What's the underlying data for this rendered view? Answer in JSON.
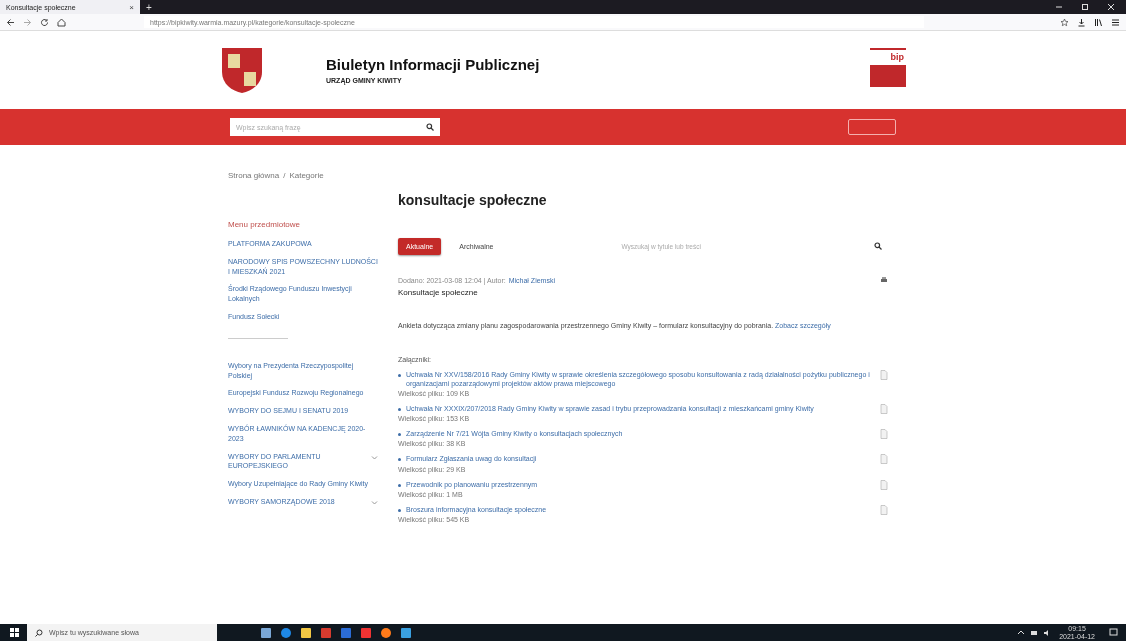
{
  "browser": {
    "tab_title": "Konsultacje społeczne",
    "tab_close": "×",
    "new_tab": "+",
    "url": "https://bipkiwity.warmia.mazury.pl/kategorie/konsultacje-spoleczne"
  },
  "header": {
    "title": "Biuletyn Informacji Publicznej",
    "subtitle": "URZĄD GMINY KIWITY",
    "badge": "bip"
  },
  "search": {
    "placeholder": "Wpisz szukaną frazę"
  },
  "breadcrumb": {
    "items": [
      "Strona główna",
      "Kategorie"
    ],
    "separator": "/"
  },
  "sidebar": {
    "heading": "Menu przedmiotowe",
    "groups": [
      [
        {
          "label": "PLATFORMA ZAKUPOWA",
          "kind": "link"
        },
        {
          "label": "NARODOWY SPIS POWSZECHNY LUDNOŚCI I MIESZKAŃ 2021",
          "kind": "link"
        },
        {
          "label": "Środki Rządowego Funduszu Inwestycji Lokalnych",
          "kind": "link"
        },
        {
          "label": "Fundusz Sołecki",
          "kind": "link"
        }
      ],
      [
        {
          "label": "Wybory na Prezydenta Rzeczypospolitej Polskiej",
          "kind": "link"
        },
        {
          "label": "Europejski Fundusz Rozwoju Regionalnego",
          "kind": "link"
        },
        {
          "label": "WYBORY DO SEJMU I SENATU 2019",
          "kind": "link"
        },
        {
          "label": "WYBÓR ŁAWNIKÓW NA KADENCJĘ 2020-2023",
          "kind": "link"
        },
        {
          "label": "WYBORY DO PARLAMENTU EUROPEJSKIEGO",
          "kind": "expandable"
        },
        {
          "label": "Wybory Uzupełniające do Rady Gminy Kiwity",
          "kind": "link"
        },
        {
          "label": "WYBORY SAMORZĄDOWE 2018",
          "kind": "expandable"
        }
      ]
    ]
  },
  "content": {
    "title": "konsultacje społeczne",
    "tabs": [
      {
        "label": "Aktualne",
        "selected": true
      },
      {
        "label": "Archiwalne",
        "selected": false
      }
    ],
    "filter_placeholder": "Wyszukaj w tytule lub treści",
    "meta": "Dodano: 2021-03-08 12:04 | Autor:",
    "author": "Michał Ziemski",
    "article_title": "Konsultacje społeczne",
    "text": "Ankieta dotycząca zmiany planu zagospodarowania przestrzennego Gminy Kiwity – formularz konsultacyjny do pobrania.",
    "text_link": "Zobacz szczegóły",
    "attachments_heading": "Załączniki:",
    "attachments": [
      {
        "name": "Uchwała Nr XXV/158/2016 Rady Gminy Kiwity w sprawie określenia szczegółowego sposobu konsultowania z radą działalności pożytku publicznego i organizacjami pozarządowymi projektów aktów prawa miejscowego",
        "size": "Wielkość pliku: 109 KB"
      },
      {
        "name": "Uchwała Nr XXXIX/207/2018 Rady Gminy Kiwity w sprawie zasad i trybu przeprowadzania konsultacji z mieszkańcami gminy Kiwity",
        "size": "Wielkość pliku: 153 KB"
      },
      {
        "name": "Zarządzenie Nr 7/21 Wójta Gminy Kiwity o konsultacjach społecznych",
        "size": "Wielkość pliku: 38 KB"
      },
      {
        "name": "Formularz Zgłaszania uwag do konsultacji",
        "size": "Wielkość pliku: 29 KB"
      },
      {
        "name": "Przewodnik po planowaniu przestrzennym",
        "size": "Wielkość pliku: 1 MB"
      },
      {
        "name": "Broszura informacyjna konsultacje społeczne",
        "size": "Wielkość pliku: 545 KB"
      }
    ]
  },
  "taskbar": {
    "search_placeholder": "Wpisz tu wyszukiwane słowa",
    "time": "09:15",
    "date": "2021-04-12"
  }
}
